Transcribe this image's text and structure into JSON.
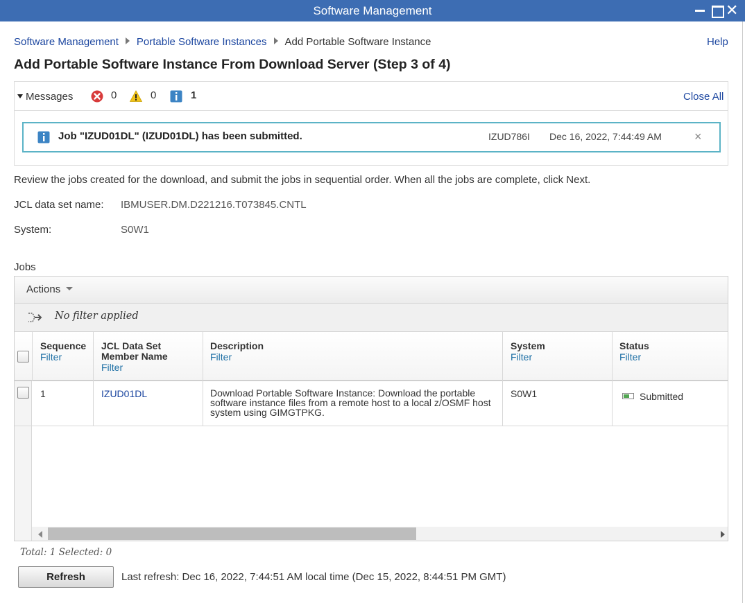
{
  "window": {
    "title": "Software Management"
  },
  "breadcrumb": {
    "items": [
      "Software Management",
      "Portable Software Instances"
    ],
    "current": "Add Portable Software Instance"
  },
  "help_label": "Help",
  "page_title": "Add Portable Software Instance From Download Server (Step 3 of 4)",
  "messages": {
    "toggle_label": "Messages",
    "error_count": "0",
    "warning_count": "0",
    "info_count": "1",
    "close_all_label": "Close All",
    "item": {
      "text": "Job \"IZUD01DL\" (IZUD01DL) has been submitted.",
      "id": "IZUD786I",
      "timestamp": "Dec 16, 2022, 7:44:49 AM"
    }
  },
  "instructions": "Review the jobs created for the download, and submit the jobs in sequential order. When all the jobs are complete, click Next.",
  "fields": {
    "jcl_label": "JCL data set name:",
    "jcl_value": "IBMUSER.DM.D221216.T073845.CNTL",
    "system_label": "System:",
    "system_value": "S0W1"
  },
  "jobs": {
    "label": "Jobs",
    "actions_label": "Actions",
    "filter_status": "No filter applied",
    "filter_link": "Filter",
    "columns": {
      "sequence": "Sequence",
      "member_line1": "JCL Data Set",
      "member_line2": "Member Name",
      "description": "Description",
      "system": "System",
      "status": "Status"
    },
    "rows": [
      {
        "sequence": "1",
        "member": "IZUD01DL",
        "description_lines": [
          "Download Portable Software Instance:  Download the portable",
          "software instance files from a remote host to a local z/OSMF host",
          "system using GIMGTPKG."
        ],
        "system": "S0W1",
        "status": "Submitted"
      }
    ],
    "totals": "Total: 1 Selected: 0"
  },
  "refresh": {
    "button_label": "Refresh",
    "last_refresh": "Last refresh: Dec 16, 2022, 7:44:51 AM local time (Dec 15, 2022, 8:44:51 PM GMT)"
  },
  "colors": {
    "titlebar": "#3d6db3",
    "link": "#1d47a0",
    "filter_link": "#1d6fa5",
    "message_border": "#5bb3c6",
    "status_green": "#52a552"
  },
  "icons": {
    "error": "error-x-circle-icon",
    "warning": "warning-triangle-icon",
    "info": "info-square-icon",
    "filter": "filter-arrows-icon",
    "status": "job-status-bar-icon"
  }
}
